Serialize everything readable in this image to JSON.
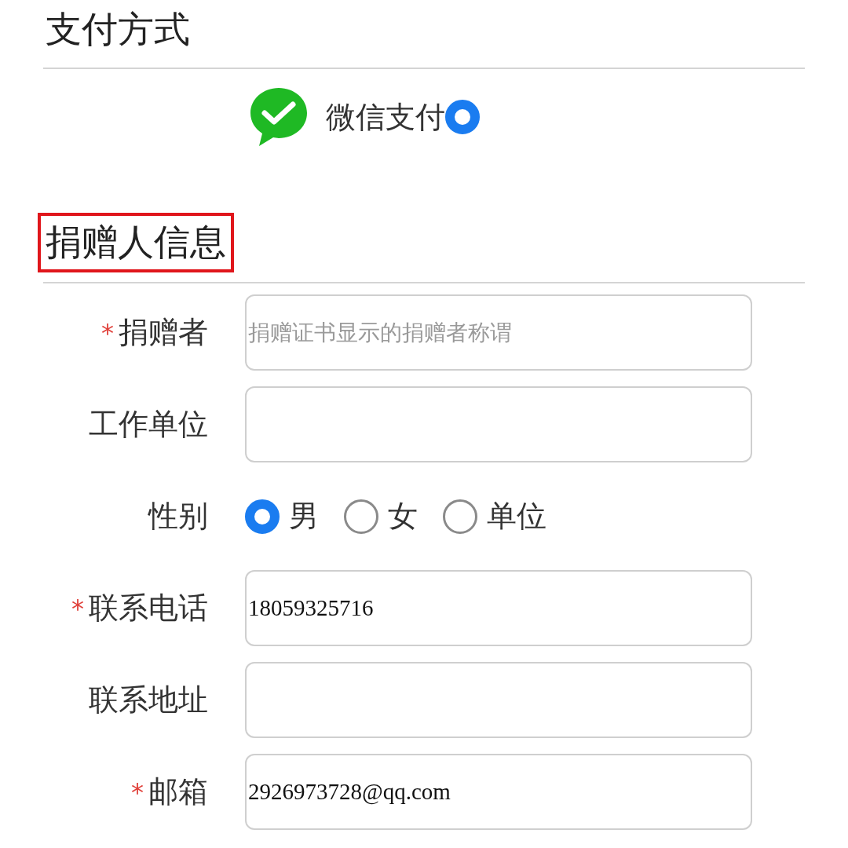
{
  "payment": {
    "title": "支付方式",
    "methods": [
      {
        "label": "微信支付",
        "selected": true
      }
    ]
  },
  "donor": {
    "title": "捐赠人信息",
    "highlighted": true,
    "fields": [
      {
        "kind": "text",
        "required_mark": "*",
        "label": "捐赠者",
        "placeholder": "捐赠证书显示的捐赠者称谓"
      },
      {
        "kind": "text",
        "label": "工作单位"
      },
      {
        "kind": "radio",
        "label": "性别",
        "options": [
          {
            "label": "男",
            "selected": true
          },
          {
            "label": "女",
            "selected": false
          },
          {
            "label": "单位",
            "selected": false
          }
        ]
      },
      {
        "kind": "text",
        "required_mark": "*",
        "label": "联系电话",
        "value": "18059325716"
      },
      {
        "kind": "text",
        "label": "联系地址"
      },
      {
        "kind": "text",
        "required_mark": "*",
        "label": "邮箱",
        "value": "2926973728@qq.com"
      }
    ]
  }
}
